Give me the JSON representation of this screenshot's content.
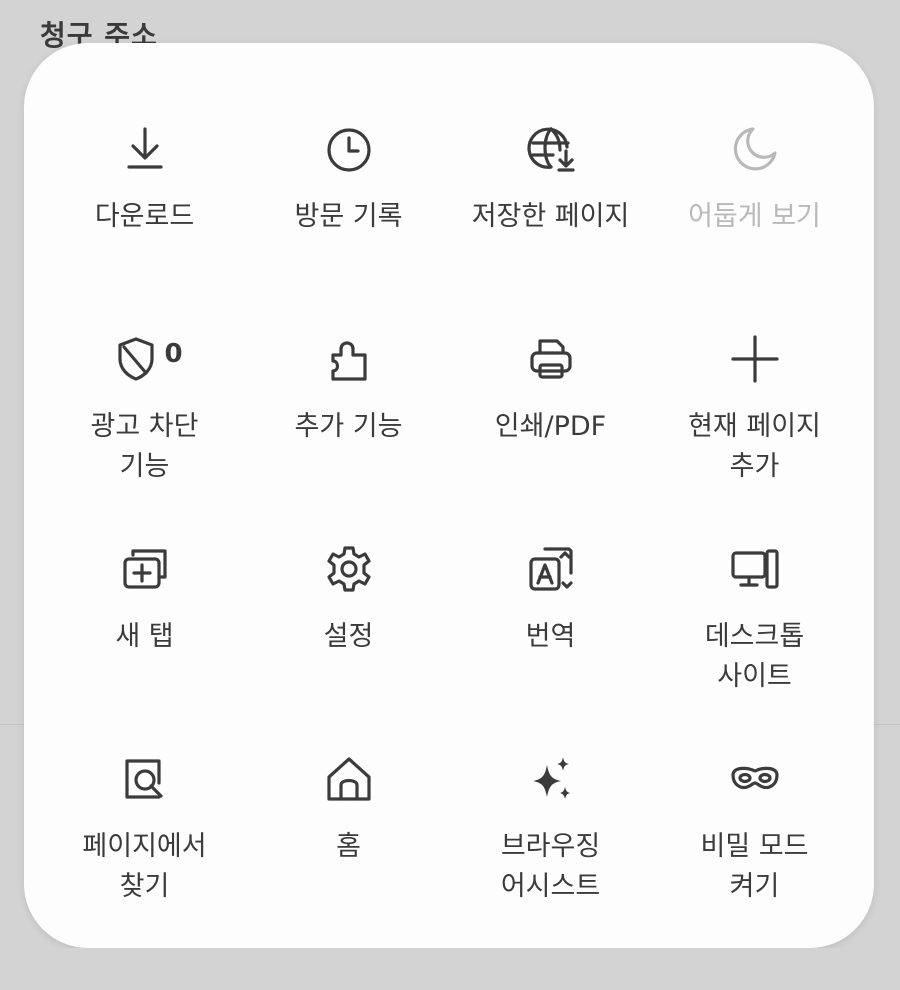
{
  "background": {
    "title": "청구 주소"
  },
  "menu": {
    "items": [
      {
        "label": "다운로드",
        "icon": "download-icon"
      },
      {
        "label": "방문 기록",
        "icon": "clock-icon"
      },
      {
        "label": "저장한 페이지",
        "icon": "globe-download-icon"
      },
      {
        "label": "어둡게 보기",
        "icon": "moon-icon",
        "disabled": true
      },
      {
        "label": "광고 차단\n기능",
        "icon": "shield-icon",
        "badge": "0"
      },
      {
        "label": "추가 기능",
        "icon": "puzzle-icon"
      },
      {
        "label": "인쇄/PDF",
        "icon": "printer-icon"
      },
      {
        "label": "현재 페이지\n추가",
        "icon": "plus-icon"
      },
      {
        "label": "새 탭",
        "icon": "new-tab-icon"
      },
      {
        "label": "설정",
        "icon": "gear-icon"
      },
      {
        "label": "번역",
        "icon": "translate-icon"
      },
      {
        "label": "데스크톱\n사이트",
        "icon": "desktop-icon"
      },
      {
        "label": "페이지에서\n찾기",
        "icon": "find-in-page-icon"
      },
      {
        "label": "홈",
        "icon": "home-icon"
      },
      {
        "label": "브라우징\n어시스트",
        "icon": "sparkle-icon"
      },
      {
        "label": "비밀 모드\n켜기",
        "icon": "mask-icon"
      }
    ]
  },
  "colors": {
    "panel": "#fdfdfd",
    "background": "#d3d3d3",
    "text": "#3b3b3b",
    "disabled": "#b9b9b9"
  }
}
